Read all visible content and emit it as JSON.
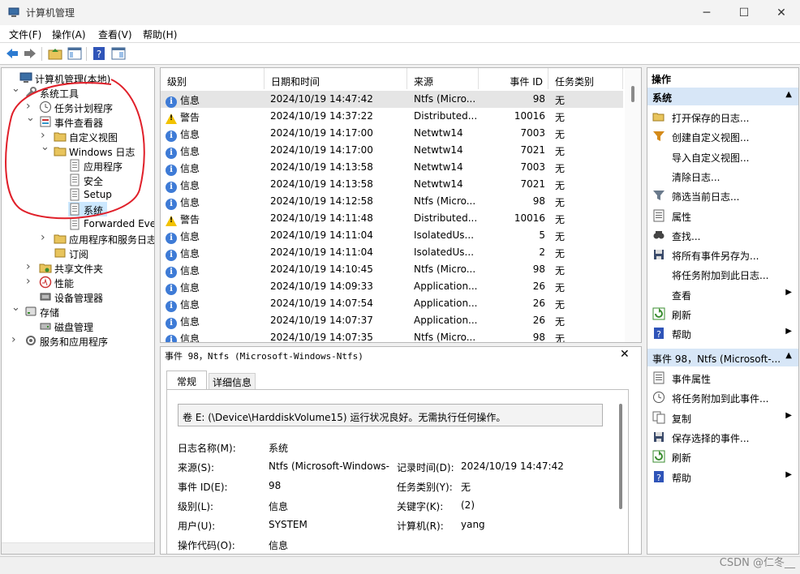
{
  "window": {
    "title": "计算机管理"
  },
  "menu": [
    "文件(F)",
    "操作(A)",
    "查看(V)",
    "帮助(H)"
  ],
  "tree": [
    {
      "label": "计算机管理(本地)",
      "icon": "computer-management-icon",
      "level": 0,
      "arrow": ""
    },
    {
      "label": "系统工具",
      "icon": "tools-icon",
      "level": 1,
      "arrow": "v"
    },
    {
      "label": "任务计划程序",
      "icon": "clock-icon",
      "level": 2,
      "arrow": ">"
    },
    {
      "label": "事件查看器",
      "icon": "event-viewer-icon",
      "level": 2,
      "arrow": "v"
    },
    {
      "label": "自定义视图",
      "icon": "folder-icon",
      "level": 3,
      "arrow": ">"
    },
    {
      "label": "Windows 日志",
      "icon": "folder-icon",
      "level": 3,
      "arrow": "v"
    },
    {
      "label": "应用程序",
      "icon": "log-icon",
      "level": 4,
      "arrow": ""
    },
    {
      "label": "安全",
      "icon": "log-icon",
      "level": 4,
      "arrow": ""
    },
    {
      "label": "Setup",
      "icon": "log-icon",
      "level": 4,
      "arrow": ""
    },
    {
      "label": "系统",
      "icon": "log-icon",
      "level": 4,
      "arrow": "",
      "selected": true
    },
    {
      "label": "Forwarded Eve",
      "icon": "log-icon",
      "level": 4,
      "arrow": ""
    },
    {
      "label": "应用程序和服务日志",
      "icon": "folder-icon",
      "level": 3,
      "arrow": ">"
    },
    {
      "label": "订阅",
      "icon": "subscription-icon",
      "level": 3,
      "arrow": ""
    },
    {
      "label": "共享文件夹",
      "icon": "shared-folder-icon",
      "level": 2,
      "arrow": ">"
    },
    {
      "label": "性能",
      "icon": "performance-icon",
      "level": 2,
      "arrow": ">"
    },
    {
      "label": "设备管理器",
      "icon": "device-manager-icon",
      "level": 2,
      "arrow": ""
    },
    {
      "label": "存储",
      "icon": "storage-icon",
      "level": 1,
      "arrow": "v"
    },
    {
      "label": "磁盘管理",
      "icon": "disk-icon",
      "level": 2,
      "arrow": ""
    },
    {
      "label": "服务和应用程序",
      "icon": "services-icon",
      "level": 1,
      "arrow": ">"
    }
  ],
  "list": {
    "columns": [
      "级别",
      "日期和时间",
      "来源",
      "事件 ID",
      "任务类别"
    ],
    "rows": [
      {
        "level": "信息",
        "type": "info",
        "datetime": "2024/10/19 14:47:42",
        "source": "Ntfs (Micro...",
        "id": "98",
        "category": "无"
      },
      {
        "level": "警告",
        "type": "warn",
        "datetime": "2024/10/19 14:37:22",
        "source": "Distributed...",
        "id": "10016",
        "category": "无"
      },
      {
        "level": "信息",
        "type": "info",
        "datetime": "2024/10/19 14:17:00",
        "source": "Netwtw14",
        "id": "7003",
        "category": "无"
      },
      {
        "level": "信息",
        "type": "info",
        "datetime": "2024/10/19 14:17:00",
        "source": "Netwtw14",
        "id": "7021",
        "category": "无"
      },
      {
        "level": "信息",
        "type": "info",
        "datetime": "2024/10/19 14:13:58",
        "source": "Netwtw14",
        "id": "7003",
        "category": "无"
      },
      {
        "level": "信息",
        "type": "info",
        "datetime": "2024/10/19 14:13:58",
        "source": "Netwtw14",
        "id": "7021",
        "category": "无"
      },
      {
        "level": "信息",
        "type": "info",
        "datetime": "2024/10/19 14:12:58",
        "source": "Ntfs (Micro...",
        "id": "98",
        "category": "无"
      },
      {
        "level": "警告",
        "type": "warn",
        "datetime": "2024/10/19 14:11:48",
        "source": "Distributed...",
        "id": "10016",
        "category": "无"
      },
      {
        "level": "信息",
        "type": "info",
        "datetime": "2024/10/19 14:11:04",
        "source": "IsolatedUs...",
        "id": "5",
        "category": "无"
      },
      {
        "level": "信息",
        "type": "info",
        "datetime": "2024/10/19 14:11:04",
        "source": "IsolatedUs...",
        "id": "2",
        "category": "无"
      },
      {
        "level": "信息",
        "type": "info",
        "datetime": "2024/10/19 14:10:45",
        "source": "Ntfs (Micro...",
        "id": "98",
        "category": "无"
      },
      {
        "level": "信息",
        "type": "info",
        "datetime": "2024/10/19 14:09:33",
        "source": "Application...",
        "id": "26",
        "category": "无"
      },
      {
        "level": "信息",
        "type": "info",
        "datetime": "2024/10/19 14:07:54",
        "source": "Application...",
        "id": "26",
        "category": "无"
      },
      {
        "level": "信息",
        "type": "info",
        "datetime": "2024/10/19 14:07:37",
        "source": "Application...",
        "id": "26",
        "category": "无"
      },
      {
        "level": "信息",
        "type": "info",
        "datetime": "2024/10/19 14:07:35",
        "source": "Ntfs (Micro...",
        "id": "98",
        "category": "无"
      }
    ]
  },
  "detail": {
    "header": "事件 98，Ntfs (Microsoft-Windows-Ntfs)",
    "tabs": [
      "常规",
      "详细信息"
    ],
    "message": "卷 E: (\\Device\\HarddiskVolume15) 运行状况良好。无需执行任何操作。",
    "fields": {
      "log_name_label": "日志名称(M):",
      "log_name": "系统",
      "source_label": "来源(S):",
      "source": "Ntfs (Microsoft-Windows-",
      "logged_label": "记录时间(D):",
      "logged": "2024/10/19 14:47:42",
      "event_id_label": "事件 ID(E):",
      "event_id": "98",
      "task_label": "任务类别(Y):",
      "task": "无",
      "level_label": "级别(L):",
      "level": "信息",
      "keywords_label": "关键字(K):",
      "keywords": "(2)",
      "user_label": "用户(U):",
      "user": "SYSTEM",
      "computer_label": "计算机(R):",
      "computer": "yang",
      "opcode_label": "操作代码(O):",
      "opcode": "信息"
    }
  },
  "actions": {
    "title": "操作",
    "section1": "系统",
    "items1": [
      {
        "label": "打开保存的日志...",
        "icon": "open-log-icon"
      },
      {
        "label": "创建自定义视图...",
        "icon": "filter-create-icon"
      },
      {
        "label": "导入自定义视图...",
        "icon": ""
      },
      {
        "label": "清除日志...",
        "icon": ""
      },
      {
        "label": "筛选当前日志...",
        "icon": "filter-icon"
      },
      {
        "label": "属性",
        "icon": "properties-icon"
      },
      {
        "label": "查找...",
        "icon": "find-icon"
      },
      {
        "label": "将所有事件另存为...",
        "icon": "save-icon"
      },
      {
        "label": "将任务附加到此日志...",
        "icon": ""
      },
      {
        "label": "查看",
        "icon": "",
        "submenu": true
      },
      {
        "label": "刷新",
        "icon": "refresh-icon"
      },
      {
        "label": "帮助",
        "icon": "help-icon",
        "submenu": true
      }
    ],
    "section2": "事件 98，Ntfs (Microsoft-...",
    "items2": [
      {
        "label": "事件属性",
        "icon": "properties-icon"
      },
      {
        "label": "将任务附加到此事件...",
        "icon": "attach-task-icon"
      },
      {
        "label": "复制",
        "icon": "copy-icon",
        "submenu": true
      },
      {
        "label": "保存选择的事件...",
        "icon": "save-icon"
      },
      {
        "label": "刷新",
        "icon": "refresh-icon"
      },
      {
        "label": "帮助",
        "icon": "help-icon",
        "submenu": true
      }
    ]
  },
  "watermark": "CSDN @仁冬__",
  "colors": {
    "accent": "#3e7bd6",
    "selection": "#cce8ff",
    "section_header": "#d7e6f7",
    "annotation": "#e0202a"
  }
}
